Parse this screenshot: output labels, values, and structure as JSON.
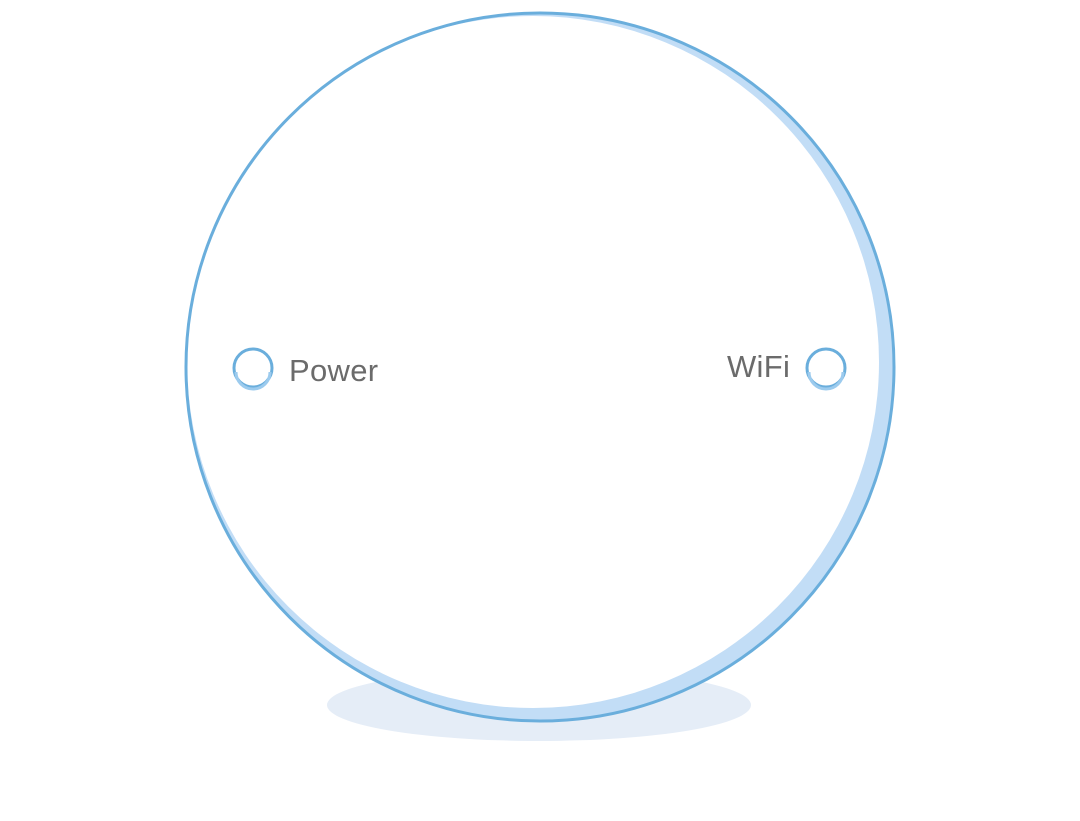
{
  "device": {
    "body_color": "#ffffff",
    "outline_color": "#6aaedc",
    "highlight_color": "#c2ddf6",
    "shadow_color": "#e5edf7"
  },
  "indicators": {
    "power": {
      "label": "Power",
      "icon": "led-indicator-icon"
    },
    "wifi": {
      "label": "WiFi",
      "icon": "led-indicator-icon"
    }
  },
  "colors": {
    "label_text": "#6b6b6b",
    "led_ring": "#6aaedc",
    "led_ring_inner": "#9ccbee"
  }
}
